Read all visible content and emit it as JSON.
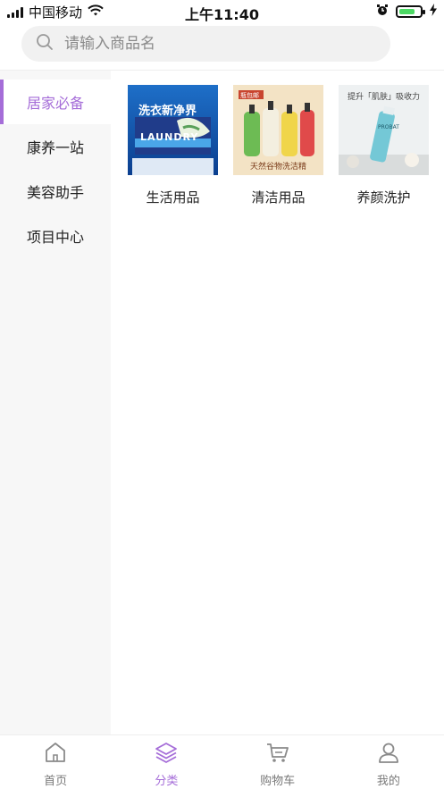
{
  "status_bar": {
    "carrier": "中国移动",
    "time": "上午11:40"
  },
  "search": {
    "placeholder": "请输入商品名"
  },
  "sidebar": {
    "items": [
      {
        "label": "居家必备",
        "active": true
      },
      {
        "label": "康养一站",
        "active": false
      },
      {
        "label": "美容助手",
        "active": false
      },
      {
        "label": "项目中心",
        "active": false
      }
    ]
  },
  "products": [
    {
      "label": "生活用品",
      "image_text": "洗衣新净界",
      "image_sub": "LAUNDRY"
    },
    {
      "label": "清洁用品",
      "image_text": "天然谷物洗洁精",
      "image_sub": "瓶包邮"
    },
    {
      "label": "养颜洗护",
      "image_text": "提升「肌肤」吸收力",
      "image_sub": "PROBAT"
    }
  ],
  "tabbar": {
    "tabs": [
      {
        "label": "首页",
        "icon": "home-icon",
        "active": false
      },
      {
        "label": "分类",
        "icon": "layers-icon",
        "active": true
      },
      {
        "label": "购物车",
        "icon": "cart-icon",
        "active": false
      },
      {
        "label": "我的",
        "icon": "user-icon",
        "active": false
      }
    ]
  },
  "colors": {
    "accent": "#a56dd8",
    "sidebar_bg": "#f7f7f7",
    "search_bg": "#f1f1f1"
  }
}
